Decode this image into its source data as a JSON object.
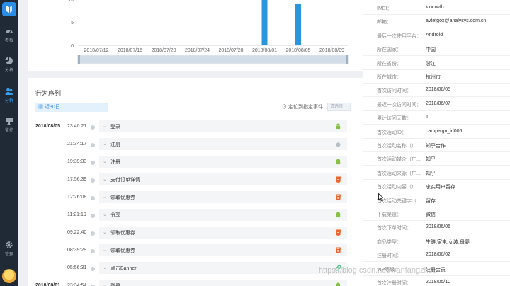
{
  "sidebar": {
    "items": [
      {
        "label": "看板",
        "icon": "dashboard-icon"
      },
      {
        "label": "分析",
        "icon": "pie-chart-icon"
      },
      {
        "label": "分群",
        "icon": "users-icon"
      },
      {
        "label": "监控",
        "icon": "monitor-icon"
      },
      {
        "label": "管理",
        "icon": "gear-icon"
      }
    ],
    "active_index": 2
  },
  "chart_data": {
    "type": "bar",
    "x_ticks": [
      "2018/07/12",
      "2018/07/16",
      "2018/07/20",
      "2018/07/24",
      "2018/07/28",
      "2018/08/01",
      "2018/08/05",
      "2018/08/09"
    ],
    "y_ticks": [
      0,
      5,
      10
    ],
    "ylim": [
      0,
      12
    ],
    "bars": [
      {
        "date": "2018/08/01",
        "value": 14
      },
      {
        "date": "2018/08/05",
        "value": 9
      }
    ],
    "bar_color": "#2a96dc"
  },
  "sequence": {
    "title": "行为序列",
    "date_range": "近30日",
    "locate_label": "定位到指定事件",
    "event_placeholder": "请选择",
    "rows": [
      {
        "day": "2018/08/05",
        "time": "23:40:21",
        "event": "登录",
        "platform": "android"
      },
      {
        "day": "",
        "time": "21:34:17",
        "event": "注册",
        "platform": "apple"
      },
      {
        "day": "",
        "time": "19:39:33",
        "event": "注册",
        "platform": "android"
      },
      {
        "day": "",
        "time": "17:56:39",
        "event": "支付订单详情",
        "platform": "html5"
      },
      {
        "day": "",
        "time": "12:26:08",
        "event": "领取优惠券",
        "platform": "html5"
      },
      {
        "day": "",
        "time": "11:21:19",
        "event": "分享",
        "platform": "android"
      },
      {
        "day": "",
        "time": "09:22:40",
        "event": "领取优惠券",
        "platform": "html5"
      },
      {
        "day": "",
        "time": "08:39:29",
        "event": "领取优惠券",
        "platform": "html5"
      },
      {
        "day": "",
        "time": "05:56:31",
        "event": "点击Banner",
        "platform": "link"
      },
      {
        "day": "2018/08/01",
        "time": "23:34:54",
        "event": "登录",
        "platform": "android"
      }
    ]
  },
  "profile": [
    {
      "k": "IMEI：",
      "v": "kiocrwfh"
    },
    {
      "k": "邮箱：",
      "v": "avtefgox@analysys.com.cn"
    },
    {
      "k": "最后一次使用平台：",
      "v": "Android"
    },
    {
      "k": "所在国家：",
      "v": "中国"
    },
    {
      "k": "所在省份：",
      "v": "浙江"
    },
    {
      "k": "所在城市：",
      "v": "杭州市"
    },
    {
      "k": "首次访问时间：",
      "v": "2018/06/05"
    },
    {
      "k": "最近一次访问时间：",
      "v": "2018/06/07"
    },
    {
      "k": "累计访问天数：",
      "v": "1"
    },
    {
      "k": "首次活动ID：",
      "v": "campaign_id006"
    },
    {
      "k": "首次活动名称（广...",
      "v": "知乎合作"
    },
    {
      "k": "首次活动媒介（广...",
      "v": "知乎"
    },
    {
      "k": "首次活动来源（广...",
      "v": "知乎"
    },
    {
      "k": "首次活动内容（广...",
      "v": "忠实用户留存"
    },
    {
      "k": "首次活动关键字（...",
      "v": "留存"
    },
    {
      "k": "下载渠道：",
      "v": "微信"
    },
    {
      "k": "首次下单时间：",
      "v": "2018/06/06"
    },
    {
      "k": "商品类型：",
      "v": "生鲜,家电,女装,母婴"
    },
    {
      "k": "注册时间：",
      "v": "2018/06/02"
    },
    {
      "k": "VIP等级：",
      "v": "注册会员"
    },
    {
      "k": "首次注册时间：",
      "v": "2018/05/10"
    }
  ],
  "watermark": "https://blog.csdn.net/wanfangzhou"
}
